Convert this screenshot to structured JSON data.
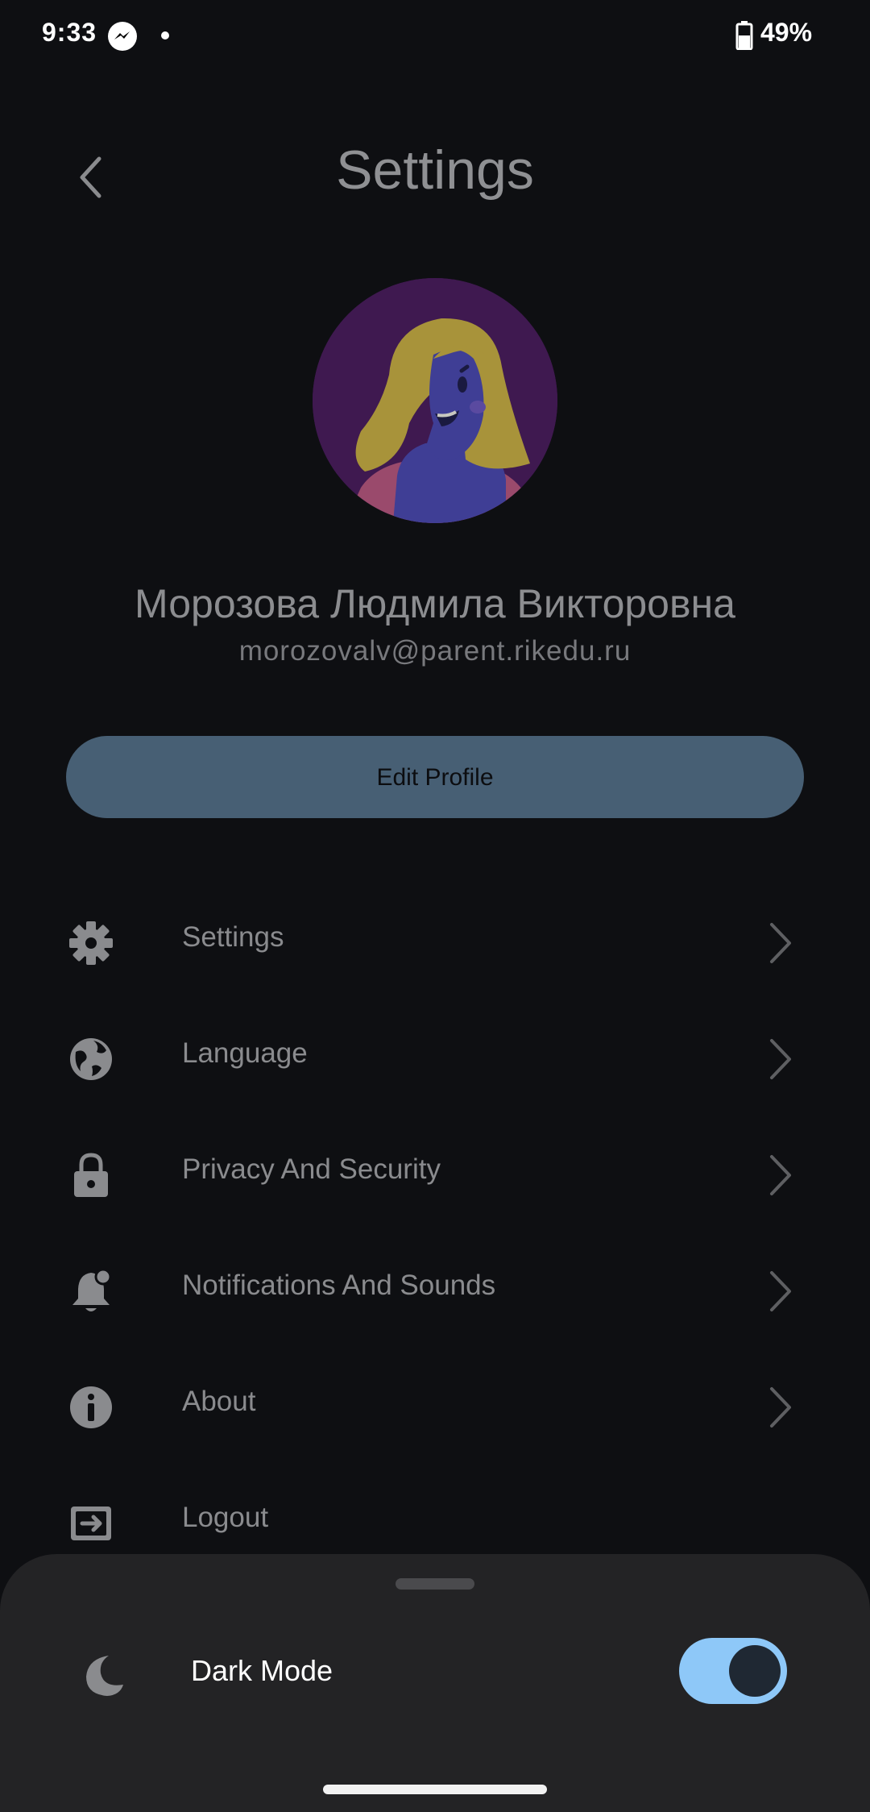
{
  "status_bar": {
    "time": "9:33",
    "battery_percent": "49%",
    "notification_icons": [
      "messenger-icon",
      "dot-icon"
    ],
    "battery_icon": "battery-icon"
  },
  "header": {
    "title": "Settings",
    "back_icon": "chevron-left-icon"
  },
  "profile": {
    "name": "Морозова Людмила Викторовна",
    "email": "morozovalv@parent.rikedu.ru",
    "edit_button_label": "Edit Profile"
  },
  "menu": {
    "items": [
      {
        "label": "Settings",
        "icon": "gear-icon"
      },
      {
        "label": "Language",
        "icon": "globe-icon"
      },
      {
        "label": "Privacy And Security",
        "icon": "lock-icon"
      },
      {
        "label": "Notifications And Sounds",
        "icon": "bell-icon"
      },
      {
        "label": "About",
        "icon": "info-icon"
      },
      {
        "label": "Logout",
        "icon": "logout-icon"
      }
    ]
  },
  "sheet": {
    "dark_mode_label": "Dark Mode",
    "dark_mode_enabled": true,
    "icon": "moon-icon"
  },
  "colors": {
    "background": "#0e0f12",
    "accent": "#8ec8f8",
    "button": "#475f74",
    "sheet": "#232325"
  }
}
